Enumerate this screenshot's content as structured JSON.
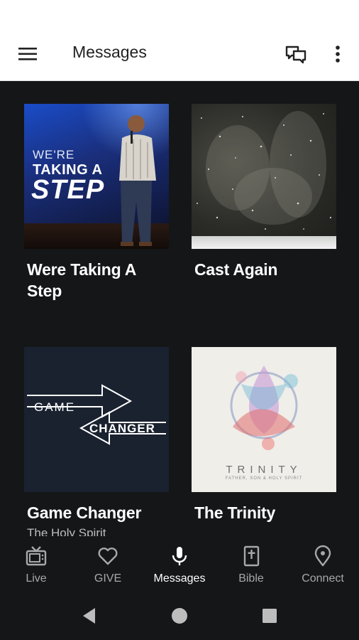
{
  "app_bar": {
    "title": "Messages",
    "menu_icon": "hamburger-menu-icon",
    "chat_icon": "chat-bubbles-icon",
    "more_icon": "more-vertical-icon"
  },
  "messages": [
    {
      "title": "Were Taking A Step",
      "thumb_text": [
        "WE'RE",
        "TAKING A",
        "STEP"
      ]
    },
    {
      "title": "Cast Again"
    },
    {
      "title": "Game Changer",
      "subtitle": "The Holy Spirit",
      "thumb_text": [
        "GAME",
        "CHANGER"
      ]
    },
    {
      "title": "The Trinity",
      "thumb_text": [
        "TRINITY",
        "FATHER, SON & HOLY SPIRIT"
      ]
    }
  ],
  "bottom_nav": {
    "active": "Messages",
    "items": [
      {
        "label": "Live",
        "icon": "tv-icon"
      },
      {
        "label": "GIVE",
        "icon": "heart-icon"
      },
      {
        "label": "Messages",
        "icon": "microphone-icon"
      },
      {
        "label": "Bible",
        "icon": "bible-icon"
      },
      {
        "label": "Connect",
        "icon": "location-pin-icon"
      }
    ]
  },
  "system_nav": {
    "back": "back-icon",
    "home": "home-icon",
    "recents": "recents-icon"
  },
  "colors": {
    "background": "#151618",
    "app_bar": "#ffffff",
    "nav_active": "#ffffff",
    "nav_inactive": "#a8a8a8"
  }
}
